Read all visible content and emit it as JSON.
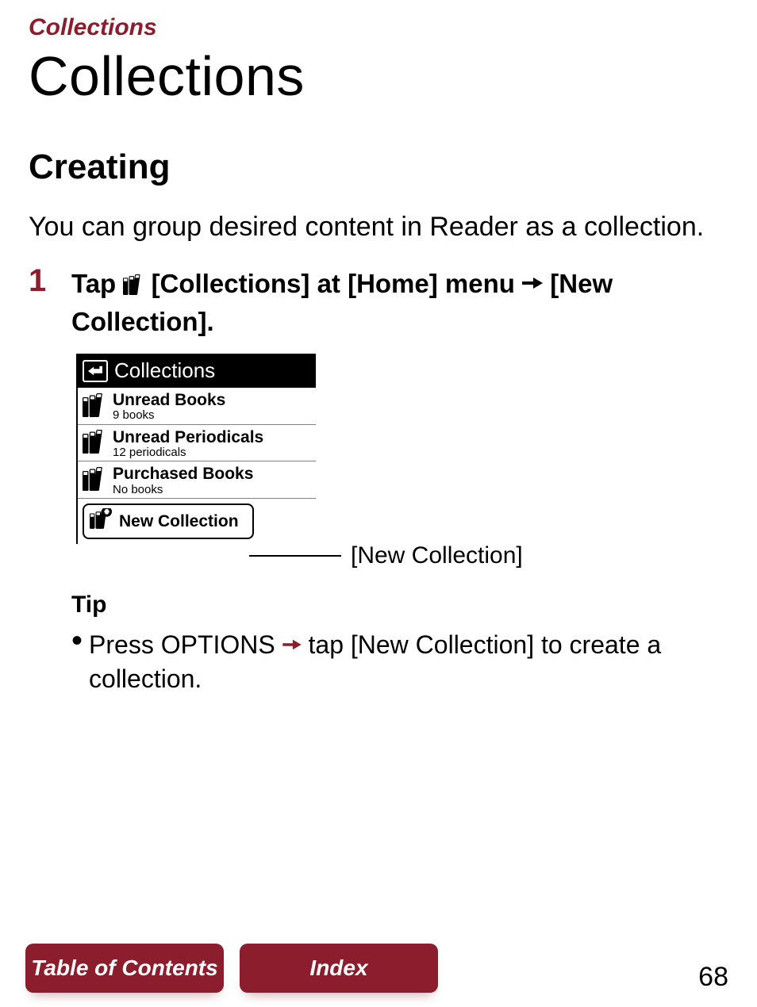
{
  "section_label": "Collections",
  "title": "Collections",
  "subheading": "Creating",
  "intro": "You can group desired content in Reader as a collection.",
  "step": {
    "num": "1",
    "pre": "Tap ",
    "mid1": " [Collections] at [Home] menu ",
    "mid2": " [New Collection]."
  },
  "device": {
    "header": "Collections",
    "rows": [
      {
        "title": "Unread Books",
        "sub": "9 books"
      },
      {
        "title": "Unread Periodicals",
        "sub": "12 periodicals"
      },
      {
        "title": "Purchased Books",
        "sub": "No books"
      }
    ],
    "new_row": "New Collection"
  },
  "callout": "[New Collection]",
  "tip": {
    "heading": "Tip",
    "pre": "Press OPTIONS ",
    "post": " tap [New Collection] to create a collection."
  },
  "footer": {
    "toc": "Table of Contents",
    "index": "Index",
    "page": "68"
  }
}
